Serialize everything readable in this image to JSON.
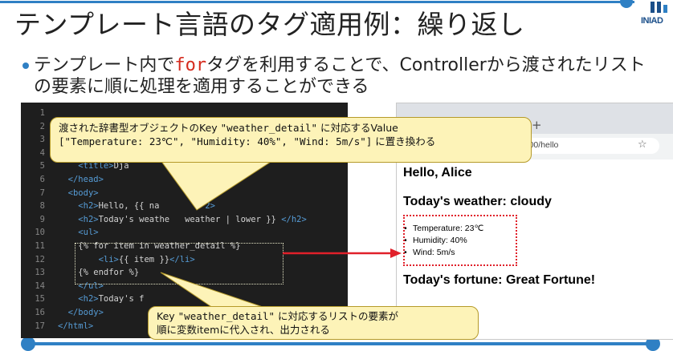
{
  "slide": {
    "title": "テンプレート言語のタグ適用例：繰り返し",
    "logo_text": "INIAD",
    "bullet_prefix": "テンプレート内で",
    "bullet_keyword": "for",
    "bullet_suffix": "タグを利用することで、Controllerから渡されたリストの要素に順に処理を適用することができる"
  },
  "code_editor": {
    "lines": [
      {
        "n": "1",
        "html": ""
      },
      {
        "n": "2",
        "html": ""
      },
      {
        "n": "3",
        "html": ""
      },
      {
        "n": "4",
        "html": ""
      },
      {
        "n": "5",
        "html": "<span class='txt'>    </span><span class='tag'>&lt;title&gt;</span><span class='txt'>Dja</span>"
      },
      {
        "n": "6",
        "html": "<span class='txt'>  </span><span class='tag'>&lt;/head&gt;</span>"
      },
      {
        "n": "7",
        "html": "<span class='txt'>  </span><span class='tag'>&lt;body&gt;</span>"
      },
      {
        "n": "8",
        "html": "<span class='txt'>    </span><span class='tag'>&lt;h2&gt;</span><span class='txt'>Hello, {{ na</span><span class='txt'>         </span><span class='tag'>2&gt;</span>"
      },
      {
        "n": "9",
        "html": "<span class='txt'>    </span><span class='tag'>&lt;h2&gt;</span><span class='txt'>Today's weathe</span><span class='txt'>   </span><span class='txt'>weather | lower }} </span><span class='tag'>&lt;/h2&gt;</span>"
      },
      {
        "n": "10",
        "html": "<span class='txt'>    </span><span class='tag'>&lt;ul&gt;</span>"
      },
      {
        "n": "11",
        "html": "<span class='txt'>    {% for item in weather_detail %}</span>"
      },
      {
        "n": "12",
        "html": "<span class='txt'>        </span><span class='tag'>&lt;li&gt;</span><span class='txt'>{{ item }}</span><span class='tag'>&lt;/li&gt;</span>"
      },
      {
        "n": "13",
        "html": "<span class='txt'>    {% endfor %}</span>"
      },
      {
        "n": "14",
        "html": "<span class='txt'>    </span><span class='tag'>&lt;/ul&gt;</span>"
      },
      {
        "n": "15",
        "html": "<span class='txt'>    </span><span class='tag'>&lt;h2&gt;</span><span class='txt'>Today's f</span>"
      },
      {
        "n": "16",
        "html": "<span class='txt'>  </span><span class='tag'>&lt;/body&gt;</span>"
      },
      {
        "n": "17",
        "html": "<span class='tag'>&lt;/html&gt;</span>"
      }
    ]
  },
  "browser": {
    "new_tab": "+",
    "url": ":8000/hello",
    "star": "☆",
    "heading_hello": "Hello, Alice",
    "heading_weather": "Today's weather: cloudy",
    "items": [
      "Temperature: 23℃",
      "Humidity: 40%",
      "Wind: 5m/s"
    ],
    "heading_fortune": "Today's fortune: Great Fortune!"
  },
  "callouts": {
    "top_line1_prefix": "渡された辞書型オブジェクトのKey ",
    "top_line1_key": "\"weather_detail\"",
    "top_line1_suffix": " に対応するValue",
    "top_line2_list": "[\"Temperature: 23℃\", \"Humidity: 40%\", \"Wind: 5m/s\"]",
    "top_line2_suffix": " に置き換わる",
    "bottom_line1_prefix": "Key ",
    "bottom_line1_key": "\"weather_detail\"",
    "bottom_line1_suffix": " に対応するリストの要素が",
    "bottom_line2": "順に変数itemに代入され、出力される"
  },
  "colors": {
    "accent": "#2f80c4",
    "arrow": "#e0202a",
    "callout_bg": "#fdf3b8"
  }
}
